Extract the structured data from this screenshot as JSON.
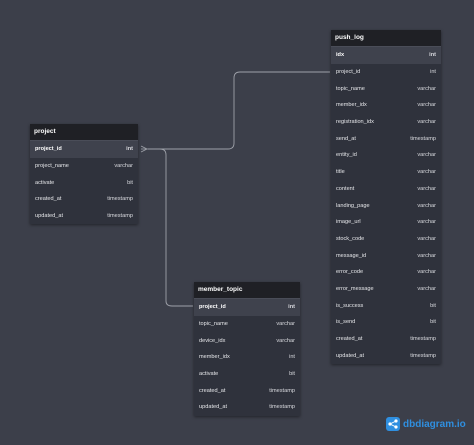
{
  "tables": {
    "project": {
      "name": "project",
      "rows": [
        {
          "name": "project_id",
          "type": "int"
        },
        {
          "name": "project_name",
          "type": "varchar"
        },
        {
          "name": "activate",
          "type": "bit"
        },
        {
          "name": "created_at",
          "type": "timestamp"
        },
        {
          "name": "updated_at",
          "type": "timestamp"
        }
      ]
    },
    "push_log": {
      "name": "push_log",
      "rows": [
        {
          "name": "idx",
          "type": "int"
        },
        {
          "name": "project_id",
          "type": "int"
        },
        {
          "name": "topic_name",
          "type": "varchar"
        },
        {
          "name": "member_idx",
          "type": "varchar"
        },
        {
          "name": "registration_idx",
          "type": "varchar"
        },
        {
          "name": "send_at",
          "type": "timestamp"
        },
        {
          "name": "entity_id",
          "type": "varchar"
        },
        {
          "name": "title",
          "type": "varchar"
        },
        {
          "name": "content",
          "type": "varchar"
        },
        {
          "name": "landing_page",
          "type": "varchar"
        },
        {
          "name": "image_url",
          "type": "varchar"
        },
        {
          "name": "stock_code",
          "type": "varchar"
        },
        {
          "name": "message_id",
          "type": "varchar"
        },
        {
          "name": "error_code",
          "type": "varchar"
        },
        {
          "name": "error_message",
          "type": "varchar"
        },
        {
          "name": "is_success",
          "type": "bit"
        },
        {
          "name": "is_send",
          "type": "bit"
        },
        {
          "name": "created_at",
          "type": "timestamp"
        },
        {
          "name": "updated_at",
          "type": "timestamp"
        }
      ]
    },
    "member_topic": {
      "name": "member_topic",
      "rows": [
        {
          "name": "project_id",
          "type": "int"
        },
        {
          "name": "topic_name",
          "type": "varchar"
        },
        {
          "name": "device_idx",
          "type": "varchar"
        },
        {
          "name": "member_idx",
          "type": "int"
        },
        {
          "name": "activate",
          "type": "bit"
        },
        {
          "name": "created_at",
          "type": "timestamp"
        },
        {
          "name": "updated_at",
          "type": "timestamp"
        }
      ]
    }
  },
  "branding": {
    "logo_text": "dbdiagram.io",
    "logo_icon": "dbdiagram-logo-icon",
    "accent_color": "#2f8fe0"
  },
  "colors": {
    "background": "#3c3f4a",
    "table_header": "#1f2025",
    "table_body": "#2f323c",
    "primary_key_row": "#3f424d",
    "link": "#9ea1a9"
  }
}
